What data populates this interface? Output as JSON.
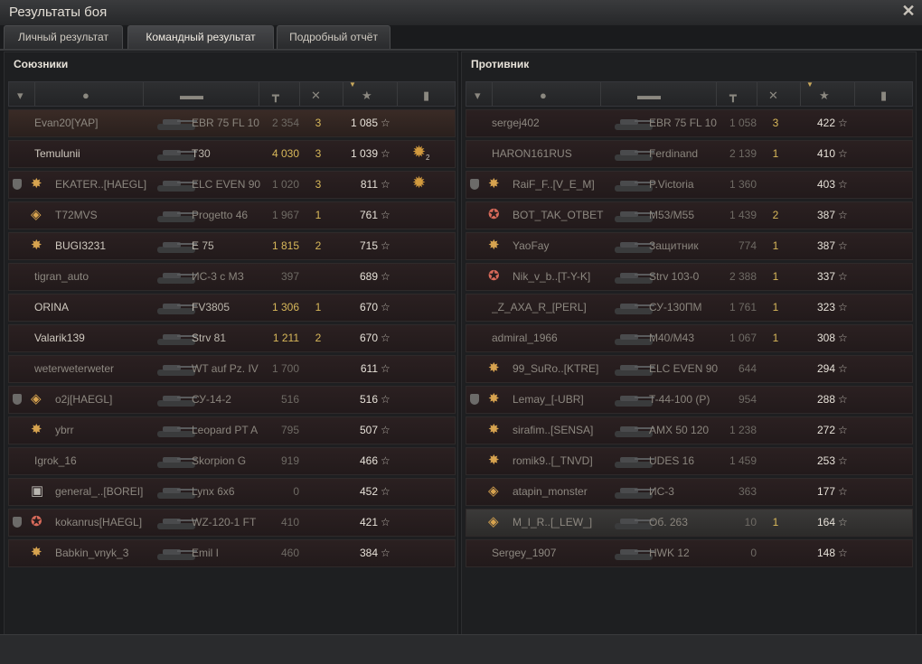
{
  "window": {
    "title": "Результаты боя",
    "close_icon": "close-icon"
  },
  "tabs": [
    {
      "label": "Личный результат",
      "active": false
    },
    {
      "label": "Командный результат",
      "active": true
    },
    {
      "label": "Подробный отчёт",
      "active": false
    }
  ],
  "allies": {
    "title": "Союзники",
    "rows": [
      {
        "name": "Evan20[YAP]",
        "tank": "EBR 75 FL 10",
        "damage": "2 354",
        "frags": "3",
        "xp": "1 085",
        "badge": "",
        "platoon": false,
        "highlight": true,
        "dmg_gold": false,
        "dim": true
      },
      {
        "name": "Temulunii",
        "tank": "T30",
        "damage": "4 030",
        "frags": "3",
        "xp": "1 039",
        "badge": "",
        "platoon": false,
        "medal": true,
        "medal_count": "2",
        "dmg_gold": true
      },
      {
        "name": "EKATER..[HAEGL]",
        "tank": "ELC EVEN 90",
        "damage": "1 020",
        "frags": "3",
        "xp": "811",
        "badge": "star",
        "platoon": true,
        "medal": true,
        "dim": true
      },
      {
        "name": "T72MVS",
        "tank": "Progetto 46",
        "damage": "1 967",
        "frags": "1",
        "xp": "761",
        "badge": "diamond",
        "platoon": false,
        "dim": true
      },
      {
        "name": "BUGI3231",
        "tank": "E 75",
        "damage": "1 815",
        "frags": "2",
        "xp": "715",
        "badge": "star",
        "platoon": false,
        "dmg_gold": true
      },
      {
        "name": "tigran_auto",
        "tank": "ИС-3 с МЗ",
        "damage": "397",
        "frags": "",
        "xp": "689",
        "badge": "",
        "platoon": false,
        "dim": true
      },
      {
        "name": "ORINA",
        "tank": "FV3805",
        "damage": "1 306",
        "frags": "1",
        "xp": "670",
        "badge": "",
        "platoon": false,
        "dmg_gold": true
      },
      {
        "name": "Valarik139",
        "tank": "Strv 81",
        "damage": "1 211",
        "frags": "2",
        "xp": "670",
        "badge": "",
        "platoon": false,
        "dmg_gold": true
      },
      {
        "name": "weterweterweter",
        "tank": "WT auf Pz. IV",
        "damage": "1 700",
        "frags": "",
        "xp": "611",
        "badge": "",
        "platoon": false,
        "dim": true
      },
      {
        "name": "o2j[HAEGL]",
        "tank": "СУ-14-2",
        "damage": "516",
        "frags": "",
        "xp": "516",
        "badge": "diamond",
        "platoon": true,
        "dim": true
      },
      {
        "name": "ybrr",
        "tank": "Leopard PT A",
        "damage": "795",
        "frags": "",
        "xp": "507",
        "badge": "star",
        "platoon": false,
        "dim": true
      },
      {
        "name": "Igrok_16",
        "tank": "Skorpion G",
        "damage": "919",
        "frags": "",
        "xp": "466",
        "badge": "",
        "platoon": false,
        "dim": true
      },
      {
        "name": "general_..[BOREI]",
        "tank": "Lynx 6x6",
        "damage": "0",
        "frags": "",
        "xp": "452",
        "badge": "gray",
        "platoon": false,
        "dim": true
      },
      {
        "name": "kokanrus[HAEGL]",
        "tank": "WZ-120-1 FT",
        "damage": "410",
        "frags": "",
        "xp": "421",
        "badge": "red",
        "platoon": true,
        "dim": true
      },
      {
        "name": "Babkin_vnyk_3",
        "tank": "Emil I",
        "damage": "460",
        "frags": "",
        "xp": "384",
        "badge": "star",
        "platoon": false,
        "dim": true
      }
    ]
  },
  "enemies": {
    "title": "Противник",
    "rows": [
      {
        "name": "sergej402",
        "tank": "EBR 75 FL 10",
        "damage": "1 058",
        "frags": "3",
        "xp": "422",
        "badge": "",
        "platoon": false,
        "dim": true
      },
      {
        "name": "HARON161RUS",
        "tank": "Ferdinand",
        "damage": "2 139",
        "frags": "1",
        "xp": "410",
        "badge": "",
        "platoon": false,
        "dim": true
      },
      {
        "name": "RaiF_F..[V_E_M]",
        "tank": "P.Victoria",
        "damage": "1 360",
        "frags": "",
        "xp": "403",
        "badge": "star",
        "platoon": true,
        "dim": true
      },
      {
        "name": "BOT_TAK_OTBET",
        "tank": "M53/M55",
        "damage": "1 439",
        "frags": "2",
        "xp": "387",
        "badge": "red",
        "platoon": false,
        "dim": true
      },
      {
        "name": "YaoFay",
        "tank": "Защитник",
        "damage": "774",
        "frags": "1",
        "xp": "387",
        "badge": "star",
        "platoon": false,
        "dim": true
      },
      {
        "name": "Nik_v_b..[T-Y-K]",
        "tank": "Strv 103-0",
        "damage": "2 388",
        "frags": "1",
        "xp": "337",
        "badge": "red",
        "platoon": false,
        "dim": true
      },
      {
        "name": "_Z_AXA_R_[PERL]",
        "tank": "СУ-130ПМ",
        "damage": "1 761",
        "frags": "1",
        "xp": "323",
        "badge": "",
        "platoon": false,
        "dim": true
      },
      {
        "name": "admiral_1966",
        "tank": "M40/M43",
        "damage": "1 067",
        "frags": "1",
        "xp": "308",
        "badge": "",
        "platoon": false,
        "dim": true
      },
      {
        "name": "99_SuRo..[KTRE]",
        "tank": "ELC EVEN 90",
        "damage": "644",
        "frags": "",
        "xp": "294",
        "badge": "star",
        "platoon": false,
        "dim": true
      },
      {
        "name": "Lemay_[-UBR]",
        "tank": "T-44-100 (P)",
        "damage": "954",
        "frags": "",
        "xp": "288",
        "badge": "star",
        "platoon": true,
        "dim": true
      },
      {
        "name": "sirafim..[SENSA]",
        "tank": "AMX 50 120",
        "damage": "1 238",
        "frags": "",
        "xp": "272",
        "badge": "star",
        "platoon": false,
        "dim": true
      },
      {
        "name": "romik9..[_TNVD]",
        "tank": "UDES 16",
        "damage": "1 459",
        "frags": "",
        "xp": "253",
        "badge": "star",
        "platoon": false,
        "dim": true
      },
      {
        "name": "atapin_monster",
        "tank": "ИС-3",
        "damage": "363",
        "frags": "",
        "xp": "177",
        "badge": "diamond",
        "platoon": false,
        "dim": true
      },
      {
        "name": "M_I_R..[_LEW_]",
        "tank": "Об. 263",
        "damage": "10",
        "frags": "1",
        "xp": "164",
        "badge": "diamond",
        "platoon": false,
        "dim": true,
        "selected": true
      },
      {
        "name": "Sergey_1907",
        "tank": "HWK 12",
        "damage": "0",
        "frags": "",
        "xp": "148",
        "badge": "",
        "platoon": false,
        "dim": true
      }
    ]
  },
  "header_icons": [
    "platoon-icon",
    "player-icon",
    "tank-icon",
    "damage-icon",
    "frags-icon",
    "xp-icon",
    "medal-icon"
  ],
  "colors": {
    "accent_gold": "#d8b85a",
    "row_bg": "#2b2021"
  },
  "star_glyph": "☆"
}
